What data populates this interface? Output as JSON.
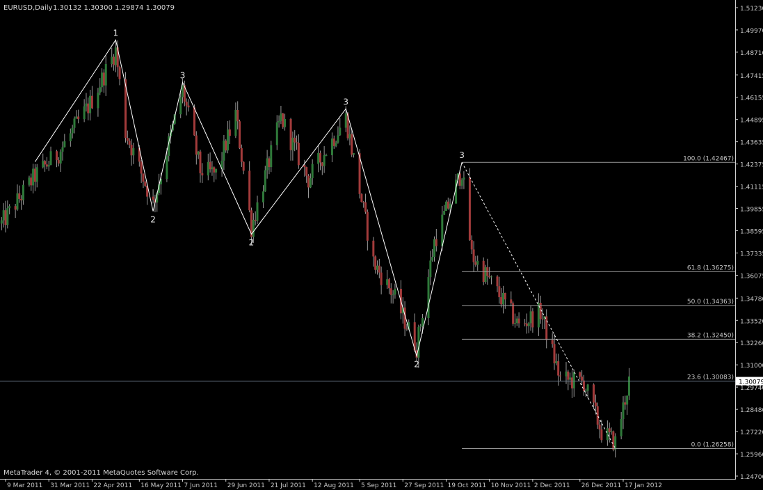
{
  "header": {
    "symbol": "EURUSD,Daily",
    "ohlc": "1.30132 1.30300 1.29874 1.30079"
  },
  "footer": {
    "copyright": "MetaTrader 4, © 2001-2011 MetaQuotes Software Corp."
  },
  "colors": {
    "background": "#000000",
    "bull_candle": "#2f7a3a",
    "bear_candle": "#a33b3b",
    "wick": "#9a9a9a",
    "zigzag": "#ffffff",
    "fibo": "#9a9a9a",
    "axis_text": "#c8c8c8",
    "price_box_bg": "#ffffff"
  },
  "chart_data": {
    "type": "candlestick",
    "symbol": "EURUSD",
    "timeframe": "Daily",
    "ylim": [
      1.247,
      1.5123
    ],
    "y_ticks": [
      "1.51230",
      "1.49970",
      "1.48710",
      "1.47415",
      "1.46155",
      "1.44895",
      "1.43635",
      "1.42375",
      "1.41115",
      "1.39855",
      "1.38595",
      "1.37335",
      "1.36075",
      "1.34780",
      "1.33520",
      "1.32260",
      "1.31000",
      "1.29740",
      "1.28480",
      "1.27220",
      "1.25960",
      "1.24700"
    ],
    "x_ticks": [
      {
        "label": "9 Mar 2011",
        "date": "2011-03-09"
      },
      {
        "label": "31 Mar 2011",
        "date": "2011-03-31"
      },
      {
        "label": "22 Apr 2011",
        "date": "2011-04-22"
      },
      {
        "label": "16 May 2011",
        "date": "2011-05-16"
      },
      {
        "label": "7 Jun 2011",
        "date": "2011-06-07"
      },
      {
        "label": "29 Jun 2011",
        "date": "2011-06-29"
      },
      {
        "label": "21 Jul 2011",
        "date": "2011-07-21"
      },
      {
        "label": "12 Aug 2011",
        "date": "2011-08-12"
      },
      {
        "label": "5 Sep 2011",
        "date": "2011-09-05"
      },
      {
        "label": "27 Sep 2011",
        "date": "2011-09-27"
      },
      {
        "label": "19 Oct 2011",
        "date": "2011-10-19"
      },
      {
        "label": "10 Nov 2011",
        "date": "2011-11-10"
      },
      {
        "label": "2 Dec 2011",
        "date": "2011-12-02"
      },
      {
        "label": "26 Dec 2011",
        "date": "2011-12-26"
      },
      {
        "label": "17 Jan 2012",
        "date": "2012-01-17"
      }
    ],
    "current_price": "1.30079",
    "zigzag": [
      {
        "date": "2011-03-24",
        "price": 1.425,
        "label": ""
      },
      {
        "date": "2011-05-04",
        "price": 1.494,
        "label": "1"
      },
      {
        "date": "2011-05-23",
        "price": 1.397,
        "label": "2"
      },
      {
        "date": "2011-06-07",
        "price": 1.47,
        "label": "3"
      },
      {
        "date": "2011-07-12",
        "price": 1.384,
        "label": "2"
      },
      {
        "date": "2011-08-29",
        "price": 1.455,
        "label": "3"
      },
      {
        "date": "2011-10-04",
        "price": 1.315,
        "label": "2"
      },
      {
        "date": "2011-10-27",
        "price": 1.4247,
        "label": "3"
      }
    ],
    "dashed_line": [
      {
        "date": "2011-10-27",
        "price": 1.4247
      },
      {
        "date": "2012-01-13",
        "price": 1.2626
      }
    ],
    "fibonacci": {
      "start_date": "2011-10-27",
      "levels": [
        {
          "label": "100.0 (1.42467)",
          "price": 1.42467
        },
        {
          "label": "61.8 (1.36275)",
          "price": 1.36275
        },
        {
          "label": "50.0 (1.34363)",
          "price": 1.34363
        },
        {
          "label": "38.2 (1.32450)",
          "price": 1.3245
        },
        {
          "label": "23.6 (1.30083)",
          "price": 1.30083
        },
        {
          "label": "0.0 (1.26258)",
          "price": 1.26258
        }
      ]
    },
    "price_path": [
      {
        "date": "2011-03-07",
        "price": 1.39
      },
      {
        "date": "2011-03-24",
        "price": 1.417
      },
      {
        "date": "2011-04-05",
        "price": 1.43
      },
      {
        "date": "2011-04-21",
        "price": 1.458
      },
      {
        "date": "2011-05-04",
        "price": 1.488
      },
      {
        "date": "2011-05-09",
        "price": 1.442
      },
      {
        "date": "2011-05-23",
        "price": 1.401
      },
      {
        "date": "2011-06-07",
        "price": 1.466
      },
      {
        "date": "2011-06-16",
        "price": 1.42
      },
      {
        "date": "2011-06-24",
        "price": 1.418
      },
      {
        "date": "2011-07-04",
        "price": 1.452
      },
      {
        "date": "2011-07-12",
        "price": 1.388
      },
      {
        "date": "2011-07-27",
        "price": 1.45
      },
      {
        "date": "2011-08-10",
        "price": 1.415
      },
      {
        "date": "2011-08-29",
        "price": 1.45
      },
      {
        "date": "2011-09-12",
        "price": 1.368
      },
      {
        "date": "2011-09-22",
        "price": 1.35
      },
      {
        "date": "2011-10-04",
        "price": 1.32
      },
      {
        "date": "2011-10-13",
        "price": 1.38
      },
      {
        "date": "2011-10-27",
        "price": 1.42
      },
      {
        "date": "2011-11-01",
        "price": 1.372
      },
      {
        "date": "2011-11-10",
        "price": 1.358
      },
      {
        "date": "2011-11-25",
        "price": 1.332
      },
      {
        "date": "2011-12-06",
        "price": 1.34
      },
      {
        "date": "2011-12-16",
        "price": 1.302
      },
      {
        "date": "2011-12-28",
        "price": 1.3
      },
      {
        "date": "2012-01-06",
        "price": 1.272
      },
      {
        "date": "2012-01-13",
        "price": 1.266
      },
      {
        "date": "2012-01-20",
        "price": 1.3008
      }
    ]
  }
}
